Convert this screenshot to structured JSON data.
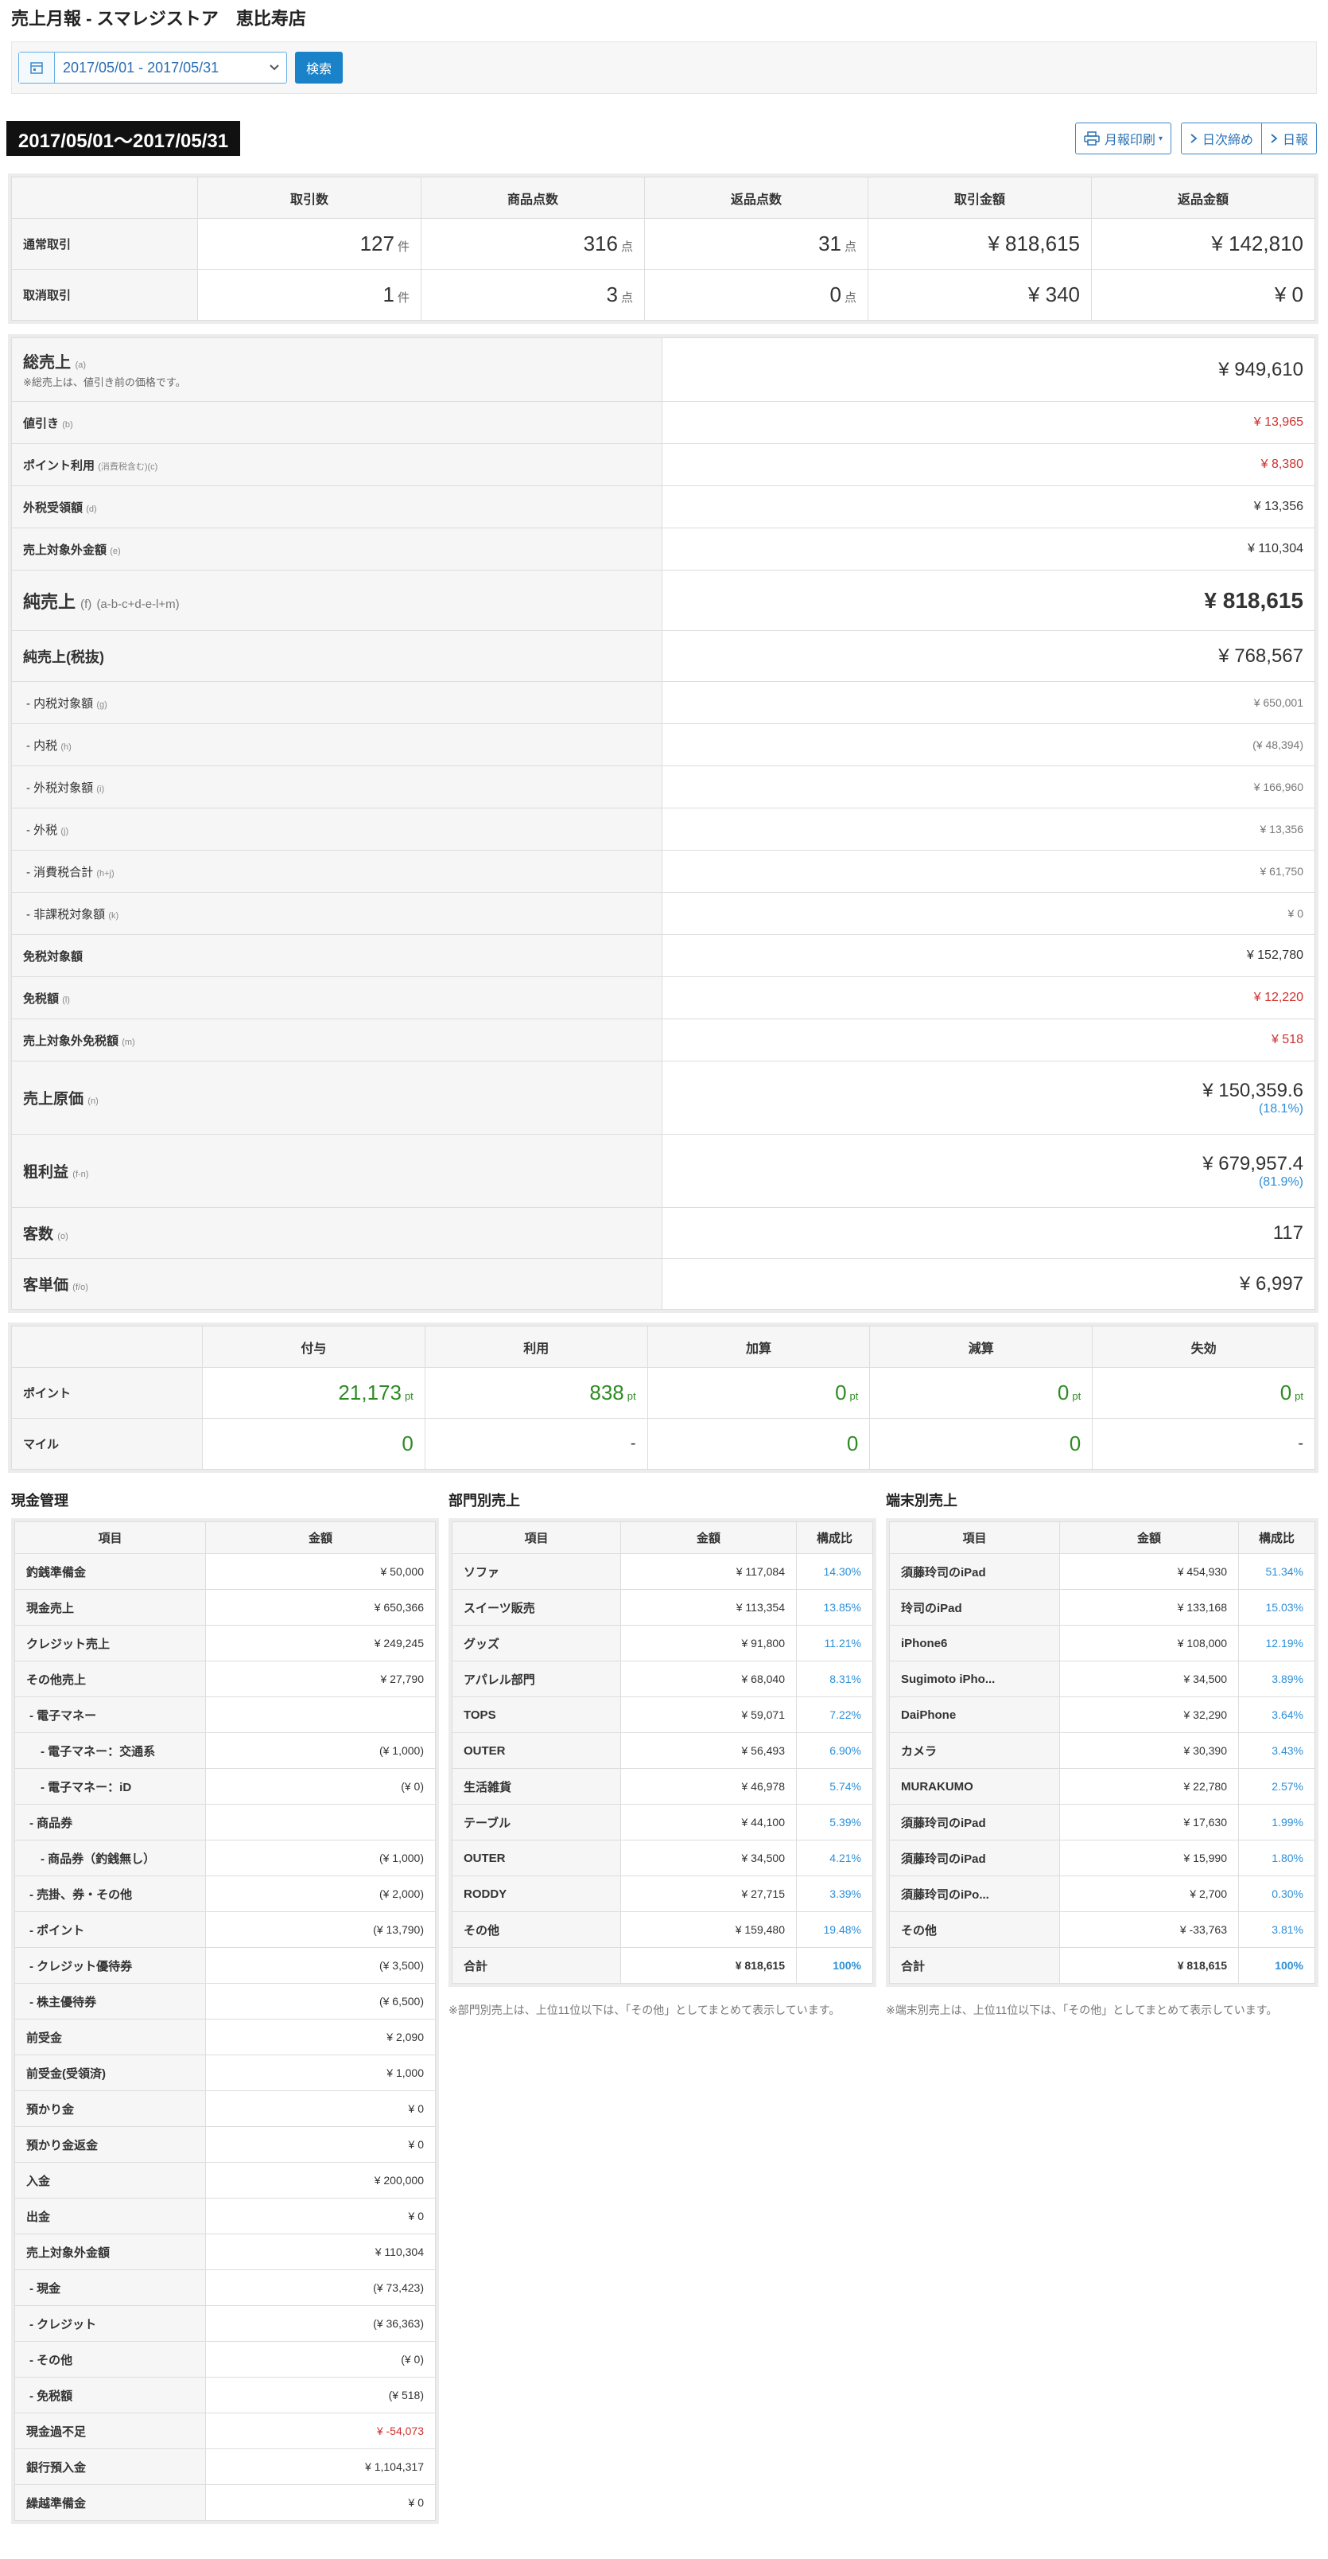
{
  "header": {
    "title": "売上月報 - スマレジストア　恵比寿店"
  },
  "search": {
    "date_range": "2017/05/01 - 2017/05/31",
    "search_label": "検索"
  },
  "period": {
    "label": "2017/05/01〜2017/05/31"
  },
  "toolbar": {
    "print_label": "月報印刷",
    "daily_close_label": "日次締め",
    "daily_label": "日報"
  },
  "transactions": {
    "headers": [
      "取引数",
      "商品点数",
      "返品点数",
      "取引金額",
      "返品金額"
    ],
    "rows": [
      {
        "label": "通常取引",
        "count": "127",
        "count_unit": "件",
        "items": "316",
        "items_unit": "点",
        "returns": "31",
        "returns_unit": "点",
        "amount": "¥ 818,615",
        "return_amount": "¥ 142,810"
      },
      {
        "label": "取消取引",
        "count": "1",
        "count_unit": "件",
        "items": "3",
        "items_unit": "点",
        "returns": "0",
        "returns_unit": "点",
        "amount": "¥ 340",
        "return_amount": "¥ 0"
      }
    ]
  },
  "summary": {
    "gross": {
      "label": "総売上",
      "code": "(a)",
      "note": "※総売上は、値引き前の価格です。",
      "value": "¥ 949,610"
    },
    "discount": {
      "label": "値引き",
      "code": "(b)",
      "value": "¥ 13,965"
    },
    "points": {
      "label": "ポイント利用",
      "code": "(消費税含む)(c)",
      "value": "¥ 8,380"
    },
    "outer_tax": {
      "label": "外税受領額",
      "code": "(d)",
      "value": "¥ 13,356"
    },
    "non_sales": {
      "label": "売上対象外金額",
      "code": "(e)",
      "value": "¥ 110,304"
    },
    "net": {
      "label": "純売上",
      "code": "(f)",
      "formula": "(a-b-c+d-e-l+m)",
      "value": "¥ 818,615"
    },
    "net_excl": {
      "label": "純売上(税抜)",
      "value": "¥ 768,567"
    },
    "incl_taxable": {
      "label": "- 内税対象額",
      "code": "(g)",
      "value": "¥ 650,001"
    },
    "incl_tax": {
      "label": "- 内税",
      "code": "(h)",
      "value": "(¥ 48,394)"
    },
    "excl_taxable": {
      "label": "- 外税対象額",
      "code": "(i)",
      "value": "¥ 166,960"
    },
    "excl_tax": {
      "label": "- 外税",
      "code": "(j)",
      "value": "¥ 13,356"
    },
    "tax_total": {
      "label": "- 消費税合計",
      "code": "(h+j)",
      "value": "¥ 61,750"
    },
    "non_taxable": {
      "label": "- 非課税対象額",
      "code": "(k)",
      "value": "¥ 0"
    },
    "tax_free_target": {
      "label": "免税対象額",
      "value": "¥ 152,780"
    },
    "tax_free": {
      "label": "免税額",
      "code": "(l)",
      "value": "¥ 12,220"
    },
    "non_sales_tax_free": {
      "label": "売上対象外免税額",
      "code": "(m)",
      "value": "¥ 518"
    },
    "cost": {
      "label": "売上原価",
      "code": "(n)",
      "value": "¥ 150,359.6",
      "ratio": "(18.1%)"
    },
    "profit": {
      "label": "粗利益",
      "code": "(f-n)",
      "value": "¥ 679,957.4",
      "ratio": "(81.9%)"
    },
    "customers": {
      "label": "客数",
      "code": "(o)",
      "value": "117"
    },
    "avg": {
      "label": "客単価",
      "code": "(f/o)",
      "value": "¥ 6,997"
    }
  },
  "loyalty": {
    "headers": [
      "付与",
      "利用",
      "加算",
      "減算",
      "失効"
    ],
    "point_label": "ポイント",
    "point_values": [
      "21,173",
      "838",
      "0",
      "0",
      "0"
    ],
    "point_unit": "pt",
    "mile_label": "マイル",
    "mile_values": [
      "0",
      "-",
      "0",
      "0",
      "-"
    ]
  },
  "cash": {
    "title": "現金管理",
    "headers": [
      "項目",
      "金額"
    ],
    "rows": [
      {
        "label": "釣銭準備金",
        "value": "¥ 50,000",
        "indent": 0
      },
      {
        "label": "現金売上",
        "value": "¥ 650,366",
        "indent": 0
      },
      {
        "label": "クレジット売上",
        "value": "¥ 249,245",
        "indent": 0
      },
      {
        "label": "その他売上",
        "value": "¥ 27,790",
        "indent": 0
      },
      {
        "label": "- 電子マネー",
        "value": "",
        "indent": 1
      },
      {
        "label": "- 電子マネー：交通系",
        "value": "(¥ 1,000)",
        "indent": 2
      },
      {
        "label": "- 電子マネー：iD",
        "value": "(¥ 0)",
        "indent": 2
      },
      {
        "label": "- 商品券",
        "value": "",
        "indent": 1
      },
      {
        "label": "- 商品券（釣銭無し）",
        "value": "(¥ 1,000)",
        "indent": 2
      },
      {
        "label": "- 売掛、券・その他",
        "value": "(¥ 2,000)",
        "indent": 1
      },
      {
        "label": "- ポイント",
        "value": "(¥ 13,790)",
        "indent": 1
      },
      {
        "label": "- クレジット優待券",
        "value": "(¥ 3,500)",
        "indent": 1
      },
      {
        "label": "- 株主優待券",
        "value": "(¥ 6,500)",
        "indent": 1
      },
      {
        "label": "前受金",
        "value": "¥ 2,090",
        "indent": 0
      },
      {
        "label": "前受金(受領済)",
        "value": "¥ 1,000",
        "indent": 0
      },
      {
        "label": "預かり金",
        "value": "¥ 0",
        "indent": 0
      },
      {
        "label": "預かり金返金",
        "value": "¥ 0",
        "indent": 0
      },
      {
        "label": "入金",
        "value": "¥ 200,000",
        "indent": 0
      },
      {
        "label": "出金",
        "value": "¥ 0",
        "indent": 0
      },
      {
        "label": "売上対象外金額",
        "value": "¥ 110,304",
        "indent": 0
      },
      {
        "label": "- 現金",
        "value": "(¥ 73,423)",
        "indent": 1
      },
      {
        "label": "- クレジット",
        "value": "(¥ 36,363)",
        "indent": 1
      },
      {
        "label": "- その他",
        "value": "(¥ 0)",
        "indent": 1
      },
      {
        "label": "- 免税額",
        "value": "(¥ 518)",
        "indent": 1
      },
      {
        "label": "現金過不足",
        "value": "¥ -54,073",
        "indent": 0,
        "red": true
      },
      {
        "label": "銀行預入金",
        "value": "¥ 1,104,317",
        "indent": 0
      },
      {
        "label": "繰越準備金",
        "value": "¥ 0",
        "indent": 0
      }
    ]
  },
  "dept": {
    "title": "部門別売上",
    "headers": [
      "項目",
      "金額",
      "構成比"
    ],
    "rows": [
      {
        "label": "ソファ",
        "value": "¥ 117,084",
        "ratio": "14.30%"
      },
      {
        "label": "スイーツ販売",
        "value": "¥ 113,354",
        "ratio": "13.85%"
      },
      {
        "label": "グッズ",
        "value": "¥ 91,800",
        "ratio": "11.21%"
      },
      {
        "label": "アパレル部門",
        "value": "¥ 68,040",
        "ratio": "8.31%"
      },
      {
        "label": "TOPS",
        "value": "¥ 59,071",
        "ratio": "7.22%"
      },
      {
        "label": "OUTER",
        "value": "¥ 56,493",
        "ratio": "6.90%"
      },
      {
        "label": "生活雑貨",
        "value": "¥ 46,978",
        "ratio": "5.74%"
      },
      {
        "label": "テーブル",
        "value": "¥ 44,100",
        "ratio": "5.39%"
      },
      {
        "label": "OUTER",
        "value": "¥ 34,500",
        "ratio": "4.21%"
      },
      {
        "label": "RODDY",
        "value": "¥ 27,715",
        "ratio": "3.39%"
      },
      {
        "label": "その他",
        "value": "¥ 159,480",
        "ratio": "19.48%"
      }
    ],
    "total": {
      "label": "合計",
      "value": "¥ 818,615",
      "ratio": "100%"
    },
    "note": "※部門別売上は、上位11位以下は、「その他」としてまとめて表示しています。"
  },
  "terminal": {
    "title": "端末別売上",
    "headers": [
      "項目",
      "金額",
      "構成比"
    ],
    "rows": [
      {
        "label": "須藤玲司のiPad",
        "value": "¥ 454,930",
        "ratio": "51.34%"
      },
      {
        "label": "玲司のiPad",
        "value": "¥ 133,168",
        "ratio": "15.03%"
      },
      {
        "label": "iPhone6",
        "value": "¥ 108,000",
        "ratio": "12.19%"
      },
      {
        "label": "Sugimoto iPho...",
        "value": "¥ 34,500",
        "ratio": "3.89%"
      },
      {
        "label": "DaiPhone",
        "value": "¥ 32,290",
        "ratio": "3.64%"
      },
      {
        "label": "カメラ",
        "value": "¥ 30,390",
        "ratio": "3.43%"
      },
      {
        "label": "MURAKUMO",
        "value": "¥ 22,780",
        "ratio": "2.57%"
      },
      {
        "label": "須藤玲司のiPad",
        "value": "¥ 17,630",
        "ratio": "1.99%"
      },
      {
        "label": "須藤玲司のiPad",
        "value": "¥ 15,990",
        "ratio": "1.80%"
      },
      {
        "label": "須藤玲司のiPo...",
        "value": "¥ 2,700",
        "ratio": "0.30%"
      },
      {
        "label": "その他",
        "value": "¥ -33,763",
        "ratio": "3.81%"
      }
    ],
    "total": {
      "label": "合計",
      "value": "¥ 818,615",
      "ratio": "100%"
    },
    "note": "※端末別売上は、上位11位以下は、「その他」としてまとめて表示しています。"
  },
  "colors": {
    "accent": "#1a82c8",
    "negative": "#d03030",
    "ratio": "#2d8fd8",
    "points": "#2e8b24"
  }
}
